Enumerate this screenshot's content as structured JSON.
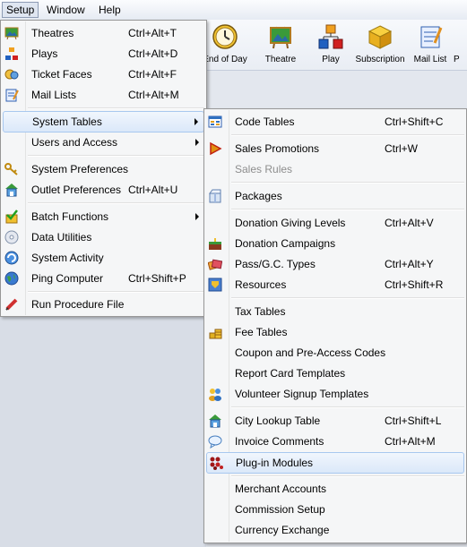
{
  "menubar": {
    "setup": "Setup",
    "window": "Window",
    "help": "Help"
  },
  "toolbar": {
    "items": [
      {
        "label": "End of Day",
        "icon": "clock-icon"
      },
      {
        "label": "Theatre",
        "icon": "theatre-easel-icon"
      },
      {
        "label": "Play",
        "icon": "play-shapes-icon"
      },
      {
        "label": "Subscription",
        "icon": "subscription-box-icon"
      },
      {
        "label": "Mail List",
        "icon": "mail-list-icon"
      },
      {
        "label": "P",
        "icon": "partial-icon"
      }
    ]
  },
  "setup_menu": {
    "items": [
      {
        "label": "Theatres",
        "shortcut": "Ctrl+Alt+T",
        "icon": "theatres-icon"
      },
      {
        "label": "Plays",
        "shortcut": "Ctrl+Alt+D",
        "icon": "plays-icon"
      },
      {
        "label": "Ticket Faces",
        "shortcut": "Ctrl+Alt+F",
        "icon": "ticket-faces-icon"
      },
      {
        "label": "Mail Lists",
        "shortcut": "Ctrl+Alt+M",
        "icon": "mail-lists-icon"
      },
      {
        "label": "System Tables",
        "shortcut": "",
        "icon": ""
      },
      {
        "label": "Users and Access",
        "shortcut": "",
        "icon": ""
      },
      {
        "label": "System Preferences",
        "shortcut": "",
        "icon": "key-icon"
      },
      {
        "label": "Outlet Preferences",
        "shortcut": "Ctrl+Alt+U",
        "icon": "outlet-house-icon"
      },
      {
        "label": "Batch Functions",
        "shortcut": "",
        "icon": "batch-check-icon"
      },
      {
        "label": "Data Utilities",
        "shortcut": "",
        "icon": "data-disc-icon"
      },
      {
        "label": "System Activity",
        "shortcut": "",
        "icon": "activity-icon"
      },
      {
        "label": "Ping Computer",
        "shortcut": "Ctrl+Shift+P",
        "icon": "globe-icon"
      },
      {
        "label": "Run Procedure File",
        "shortcut": "",
        "icon": "procedure-pen-icon"
      }
    ]
  },
  "system_tables_menu": {
    "items": [
      {
        "label": "Code Tables",
        "shortcut": "Ctrl+Shift+C",
        "icon": "code-tables-icon"
      },
      {
        "label": "Sales Promotions",
        "shortcut": "Ctrl+W",
        "icon": "play-arrow-icon"
      },
      {
        "label": "Sales Rules",
        "shortcut": "",
        "icon": ""
      },
      {
        "label": "Packages",
        "shortcut": "",
        "icon": "package-icon"
      },
      {
        "label": "Donation Giving Levels",
        "shortcut": "Ctrl+Alt+V",
        "icon": ""
      },
      {
        "label": "Donation Campaigns",
        "shortcut": "",
        "icon": "campaign-cake-icon"
      },
      {
        "label": "Pass/G.C. Types",
        "shortcut": "Ctrl+Alt+Y",
        "icon": "tickets-icon"
      },
      {
        "label": "Resources",
        "shortcut": "Ctrl+Shift+R",
        "icon": "resources-icon"
      },
      {
        "label": "Tax Tables",
        "shortcut": "",
        "icon": ""
      },
      {
        "label": "Fee Tables",
        "shortcut": "",
        "icon": "coins-icon"
      },
      {
        "label": "Coupon and Pre-Access Codes",
        "shortcut": "",
        "icon": ""
      },
      {
        "label": "Report Card Templates",
        "shortcut": "",
        "icon": ""
      },
      {
        "label": "Volunteer Signup Templates",
        "shortcut": "",
        "icon": "volunteers-icon"
      },
      {
        "label": "City Lookup Table",
        "shortcut": "Ctrl+Shift+L",
        "icon": "city-house-icon"
      },
      {
        "label": "Invoice Comments",
        "shortcut": "Ctrl+Alt+M",
        "icon": "comment-bubble-icon"
      },
      {
        "label": "Plug-in Modules",
        "shortcut": "",
        "icon": "plugin-dots-icon"
      },
      {
        "label": "Merchant Accounts",
        "shortcut": "",
        "icon": ""
      },
      {
        "label": "Commission Setup",
        "shortcut": "",
        "icon": ""
      },
      {
        "label": "Currency Exchange",
        "shortcut": "",
        "icon": ""
      }
    ]
  },
  "colors": {
    "highlight_border": "#a8c8ef",
    "disabled_text": "#8d8d8d",
    "menu_bg": "#f5f6f7"
  }
}
